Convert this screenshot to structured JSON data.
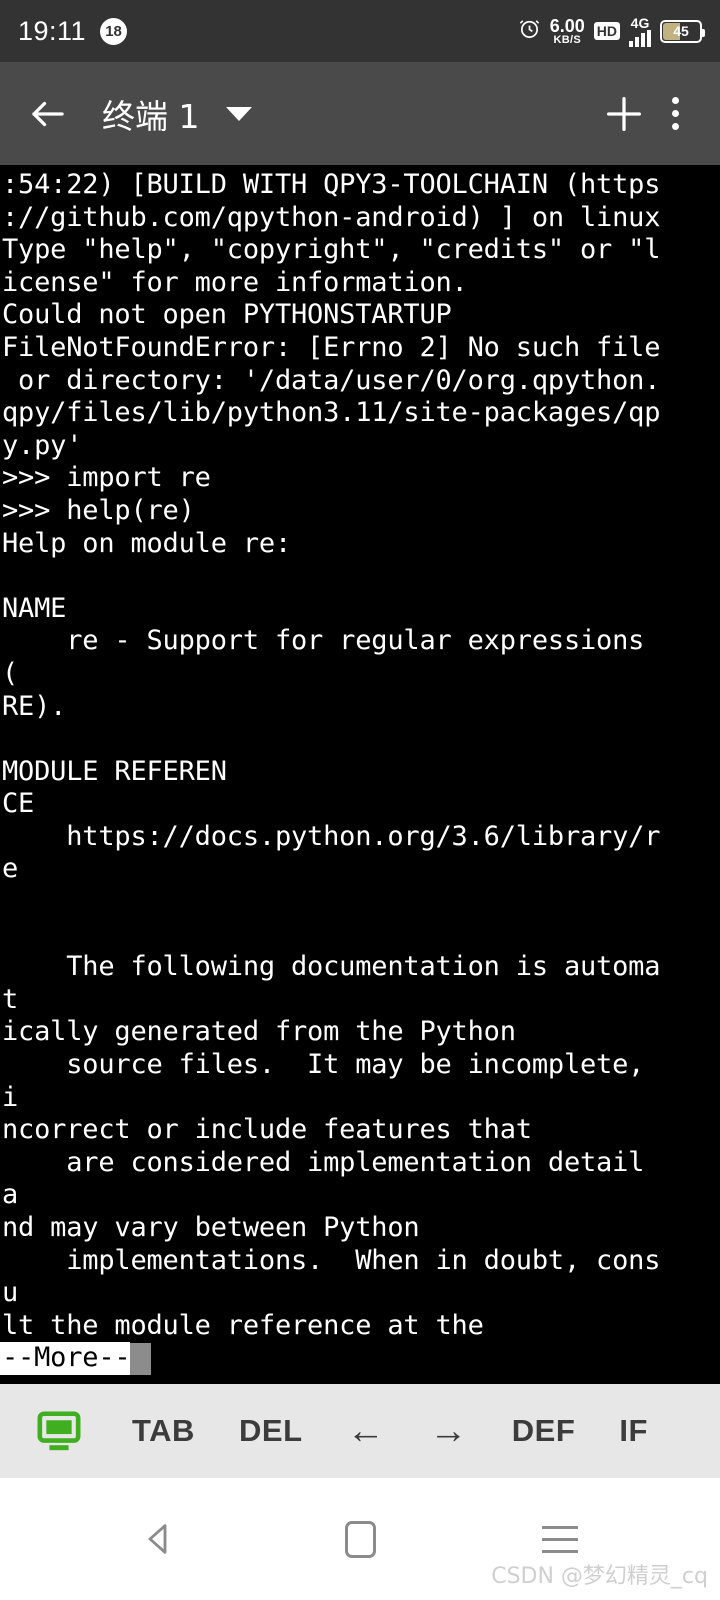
{
  "statusbar": {
    "time": "19:11",
    "notification_count": "18",
    "alarm_icon": "alarm-clock-icon",
    "net_speed_value": "6.00",
    "net_speed_unit": "KB/S",
    "hd_label": "HD",
    "network_type": "4G",
    "battery_percent": "45",
    "battery_fill_color": "#c2b280"
  },
  "appbar": {
    "back_icon": "back-arrow-icon",
    "title": "终端 1",
    "dropdown_icon": "chevron-down-icon",
    "add_icon": "plus-icon",
    "overflow_icon": "overflow-menu-icon",
    "background": "#4a4a4a"
  },
  "terminal": {
    "background": "#000000",
    "foreground": "#ffffff",
    "lines": [
      ":54:22) [BUILD WITH QPY3-TOOLCHAIN (https",
      "://github.com/qpython-android) ] on linux",
      "Type \"help\", \"copyright\", \"credits\" or \"l",
      "icense\" for more information.",
      "Could not open PYTHONSTARTUP",
      "FileNotFoundError: [Errno 2] No such file",
      " or directory: '/data/user/0/org.qpython.",
      "qpy/files/lib/python3.11/site-packages/qp",
      "y.py'",
      ">>> import re",
      ">>> help(re)",
      "Help on module re:",
      "",
      "NAME",
      "    re - Support for regular expressions",
      "(",
      "RE).",
      "",
      "MODULE REFEREN",
      "CE",
      "    https://docs.python.org/3.6/library/r",
      "e",
      "",
      "",
      "    The following documentation is automa",
      "t",
      "ically generated from the Python",
      "    source files.  It may be incomplete,",
      "i",
      "ncorrect or include features that",
      "    are considered implementation detail",
      "a",
      "nd may vary between Python",
      "    implementations.  When in doubt, cons",
      "u",
      "lt the module reference at the"
    ],
    "more_prompt": "--More--",
    "cursor_color": "#8c8c8c"
  },
  "keybar": {
    "background": "#e7e7e7",
    "terminal_icon": "terminal-monitor-icon",
    "terminal_icon_color": "#3fae1f",
    "keys": [
      {
        "label": "TAB",
        "name": "key-tab"
      },
      {
        "label": "DEL",
        "name": "key-del"
      },
      {
        "label": "←",
        "name": "key-arrow-left"
      },
      {
        "label": "→",
        "name": "key-arrow-right"
      },
      {
        "label": "DEF",
        "name": "key-def"
      },
      {
        "label": "IF",
        "name": "key-if"
      }
    ]
  },
  "navbar": {
    "back_icon": "nav-back-icon",
    "home_icon": "nav-home-icon",
    "recents_icon": "nav-recents-icon",
    "watermark": "CSDN @梦幻精灵_cq"
  }
}
